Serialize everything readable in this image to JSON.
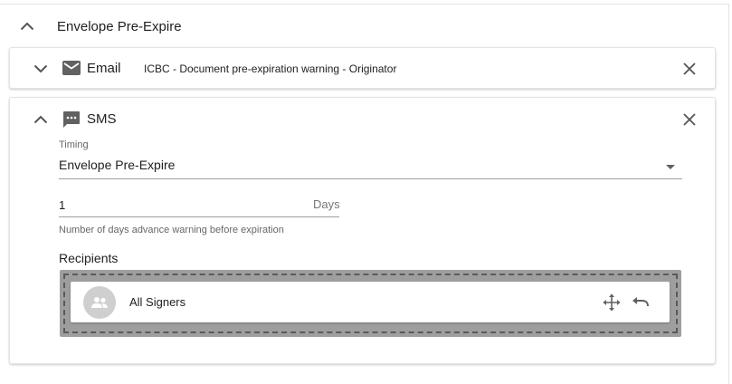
{
  "section": {
    "title": "Envelope Pre-Expire"
  },
  "email_card": {
    "type_label": "Email",
    "subject": "ICBC - Document pre-expiration warning - Originator"
  },
  "sms_card": {
    "type_label": "SMS",
    "timing": {
      "label": "Timing",
      "value": "Envelope Pre-Expire"
    },
    "days": {
      "value": "1",
      "suffix": "Days",
      "hint": "Number of days advance warning before expiration"
    },
    "recipients": {
      "label": "Recipients",
      "items": [
        {
          "name": "All Signers",
          "icon": "group-icon"
        }
      ]
    }
  },
  "icons": {
    "collapse": "chevron-up-icon",
    "expand": "chevron-down-icon",
    "email": "mail-icon",
    "sms": "sms-icon",
    "close": "close-icon",
    "move": "move-icon",
    "undo": "undo-icon",
    "dropdown": "arrow-drop-down-icon"
  }
}
